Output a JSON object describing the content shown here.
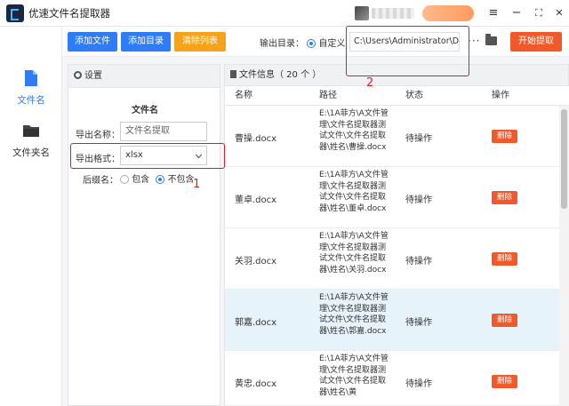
{
  "app": {
    "title": "优速文件名提取器"
  },
  "window_controls": {
    "menu": "≡",
    "minimize": "−",
    "maximize": "⛶",
    "close": "✕"
  },
  "colors": {
    "primary": "#2e7cf6",
    "danger": "#f05a2b",
    "warning": "#f7a21b",
    "annotation": "#e31c23"
  },
  "sidebar": {
    "items": [
      {
        "label": "文件名",
        "icon": "file-icon",
        "active": true
      },
      {
        "label": "文件夹名",
        "icon": "folder-icon",
        "active": false
      }
    ]
  },
  "toolbar": {
    "add_file": "添加文件",
    "add_dir": "添加目录",
    "clear_list": "清除列表",
    "output_label": "输出目录：",
    "output_mode": "自定义",
    "output_path": "C:\\Users\\Administrator\\Deskto",
    "more": "···",
    "start": "开始提取"
  },
  "settings": {
    "header": "设置",
    "section_title": "文件名",
    "export_name_label": "导出名称：",
    "export_name_placeholder": "文件名提取",
    "export_format_label": "导出格式：",
    "export_format_value": "xlsx",
    "suffix_label": "后缀名：",
    "suffix_options": [
      "包含",
      "不包含"
    ],
    "suffix_selected": "不包含"
  },
  "file_list": {
    "header": "文件信息（ 20 个 ）",
    "columns": [
      "名称",
      "路径",
      "状态",
      "操作"
    ],
    "rows": [
      {
        "name": "曹操.docx",
        "path": "E:\\1A菲方\\A文件管理\\文件名提取器测试文件\\文件名提取器\\姓名\\曹操.docx",
        "status": "待操作",
        "action": "删除"
      },
      {
        "name": "董卓.docx",
        "path": "E:\\1A菲方\\A文件管理\\文件名提取器测试文件\\文件名提取器\\姓名\\董卓.docx",
        "status": "待操作",
        "action": "删除"
      },
      {
        "name": "关羽.docx",
        "path": "E:\\1A菲方\\A文件管理\\文件名提取器测试文件\\文件名提取器\\姓名\\关羽.docx",
        "status": "待操作",
        "action": "删除"
      },
      {
        "name": "郭嘉.docx",
        "path": "E:\\1A菲方\\A文件管理\\文件名提取器测试文件\\文件名提取器\\姓名\\郭嘉.docx",
        "status": "待操作",
        "action": "删除"
      },
      {
        "name": "黄忠.docx",
        "path": "E:\\1A菲方\\A文件管理\\文件名提取器测试文件\\文件名提取器\\姓名\\黄",
        "status": "待操作",
        "action": "删除"
      }
    ]
  },
  "annotations": {
    "marker1": "1",
    "marker2": "2"
  }
}
